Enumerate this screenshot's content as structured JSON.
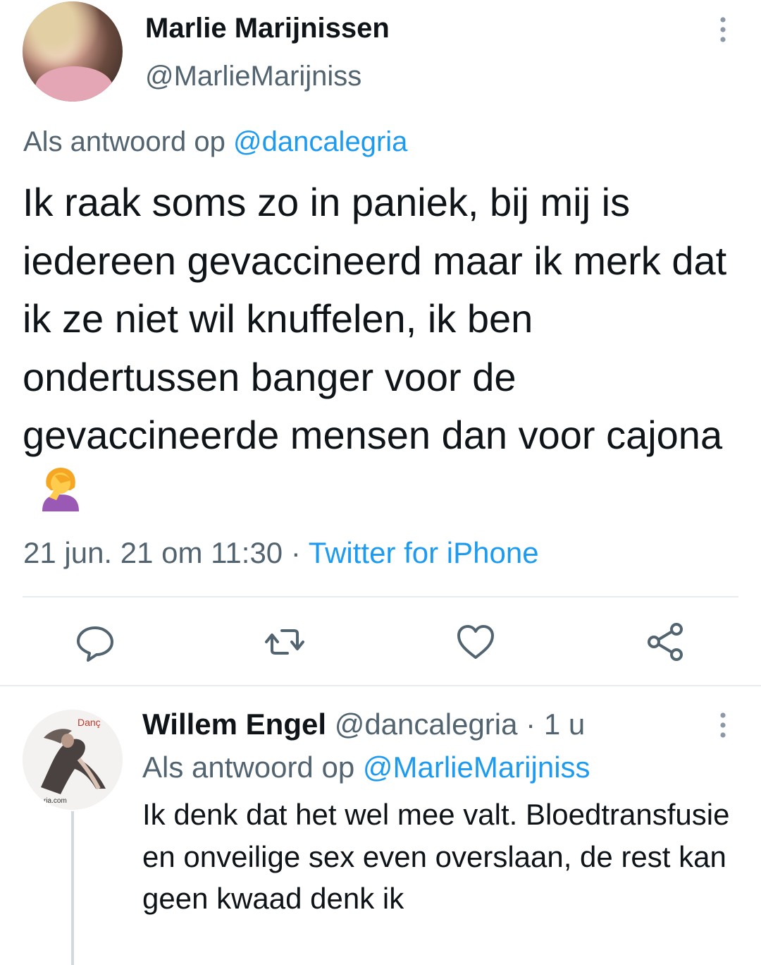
{
  "tweet": {
    "author_name": "Marlie Marijnissen",
    "author_handle": "@MarlieMarijniss",
    "reply_prefix": "Als antwoord op",
    "reply_handle": "@dancalegria",
    "text": "Ik raak soms zo in paniek, bij mij is iedereen gevaccineerd maar ik merk dat ik ze niet wil knuffelen, ik ben ondertussen banger voor de gevaccineerde mensen dan voor cajona",
    "emoji_icon": "woman-facepalming-icon",
    "timestamp": "21 jun. 21 om 11:30",
    "separator": "·",
    "source": "Twitter for iPhone",
    "actions": [
      "reply-icon",
      "retweet-icon",
      "like-icon",
      "share-icon"
    ]
  },
  "reply": {
    "author_name": "Willem Engel",
    "author_handle": "@dancalegria",
    "separator": "·",
    "time_ago": "1 u",
    "reply_prefix": "Als antwoord op",
    "reply_handle": "@MarlieMarijniss",
    "text": "Ik denk dat het wel mee valt. Bloedtransfusie en onveilige sex even overslaan, de rest kan geen kwaad denk ik",
    "avatar_logo_text": "Danç",
    "avatar_footer_text": "ria.com"
  },
  "colors": {
    "accent": "#1d9bf0",
    "muted": "#536471",
    "text": "#0f1419",
    "divider": "#e6ecf0"
  }
}
